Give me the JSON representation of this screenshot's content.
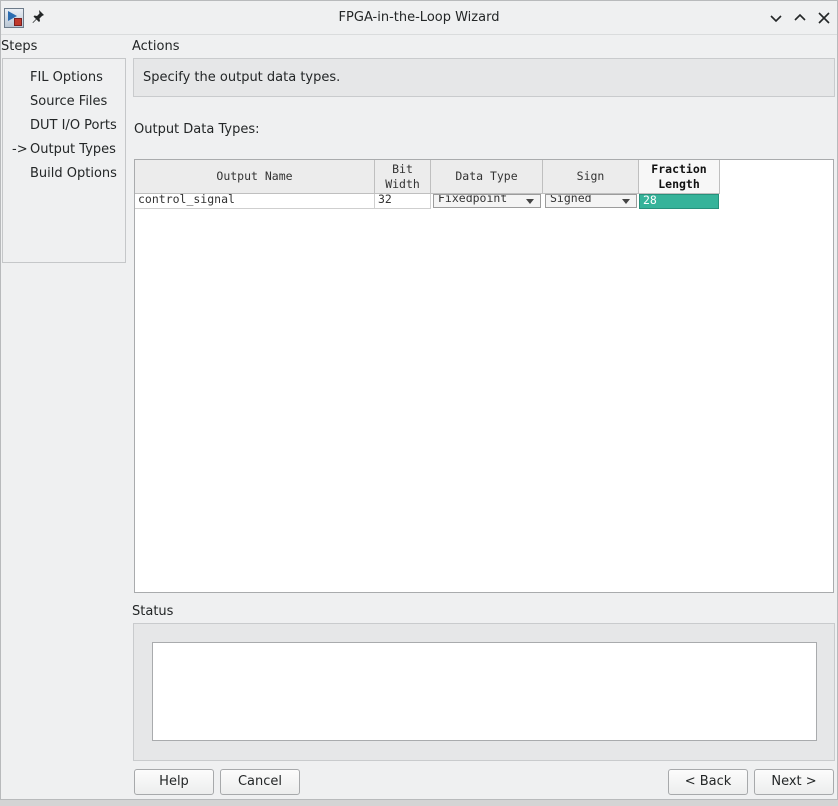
{
  "window": {
    "title": "FPGA-in-the-Loop Wizard",
    "icons": {
      "app": "fil-app-icon",
      "pin": "pin-icon",
      "minimize": "chevron-down-icon",
      "maximize": "chevron-up-icon",
      "close": "close-icon"
    }
  },
  "steps": {
    "heading": "Steps",
    "current_marker": "->",
    "items": [
      {
        "label": "FIL Options"
      },
      {
        "label": "Source Files"
      },
      {
        "label": "DUT I/O Ports"
      },
      {
        "label": "Output Types"
      },
      {
        "label": "Build Options"
      }
    ]
  },
  "actions": {
    "heading": "Actions",
    "text": "Specify the output data types."
  },
  "output_types": {
    "heading": "Output Data Types:",
    "columns": {
      "name": "Output Name",
      "bit_width": "Bit\nWidth",
      "data_type": "Data Type",
      "sign": "Sign",
      "fraction_length": "Fraction\nLength"
    },
    "rows": [
      {
        "name": "control_signal",
        "bit_width": "32",
        "data_type": "Fixedpoint",
        "sign": "Signed",
        "fraction_length": "28"
      }
    ]
  },
  "status": {
    "heading": "Status",
    "text": ""
  },
  "buttons": {
    "help": "Help",
    "cancel": "Cancel",
    "back": "< Back",
    "next": "Next >"
  },
  "colors": {
    "selected_cell": "#36b39a",
    "window_bg": "#eff0f1"
  }
}
